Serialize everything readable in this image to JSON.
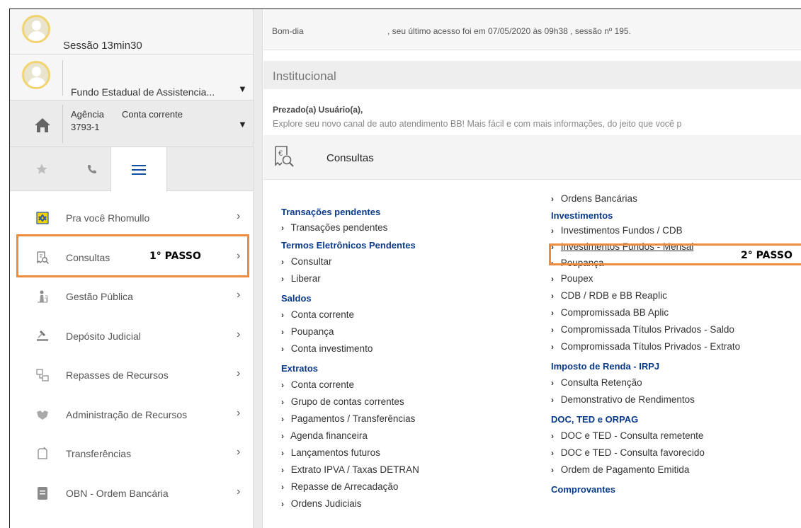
{
  "session": {
    "label": "Sessão 13min30"
  },
  "account": {
    "name": "Fundo Estadual de Assistencia..."
  },
  "agency": {
    "agency_label": "Agência",
    "account_label": "Conta corrente",
    "agency_number": "3793-1"
  },
  "tabs": [
    {
      "name": "favorites",
      "icon": "star-icon"
    },
    {
      "name": "phone",
      "icon": "phone-icon"
    },
    {
      "name": "menu",
      "icon": "menu-icon",
      "active": true
    }
  ],
  "nav": [
    {
      "label": "Pra você Rhomullo",
      "icon": "bb-logo-icon"
    },
    {
      "label": "Consultas",
      "icon": "receipt-search-icon",
      "annotation": "1° PASSO"
    },
    {
      "label": "Gestão Pública",
      "icon": "people-icon"
    },
    {
      "label": "Depósito Judicial",
      "icon": "gavel-icon"
    },
    {
      "label": "Repasses de Recursos",
      "icon": "transfer-boxes-icon"
    },
    {
      "label": "Administração de Recursos",
      "icon": "handshake-icon"
    },
    {
      "label": "Transferências",
      "icon": "transfer-icon"
    },
    {
      "label": "OBN - Ordem Bancária",
      "icon": "document-icon"
    }
  ],
  "nav_arrow": "›",
  "greeting": {
    "hello": "Bom-dia",
    "rest": ", seu último acesso foi em 07/05/2020 às 09h38 , sessão nº 195."
  },
  "section_title": "Institucional",
  "message": {
    "salutation": "Prezado(a) Usuário(a),",
    "text": "Explore seu novo canal de auto atendimento BB! Mais fácil e com mais informações, do jeito que você p"
  },
  "consultas_title": "Consultas",
  "left_column": [
    {
      "title": "Transações pendentes",
      "links": [
        "Transações pendentes"
      ]
    },
    {
      "title": "Termos Eletrônicos Pendentes",
      "links": [
        "Consultar",
        "Liberar"
      ]
    },
    {
      "title": "Saldos",
      "links": [
        "Conta corrente",
        "Poupança",
        "Conta investimento"
      ]
    },
    {
      "title": "Extratos",
      "links": [
        "Conta corrente",
        "Grupo de contas correntes",
        "Pagamentos / Transferências",
        "Agenda financeira",
        "Lançamentos futuros",
        "Extrato IPVA / Taxas DETRAN",
        "Repasse de Arrecadação",
        "Ordens Judiciais"
      ]
    }
  ],
  "right_column": {
    "top_link": "Ordens Bancárias",
    "sections": [
      {
        "title": "Investimentos",
        "links": [
          "Investimentos Fundos / CDB",
          "Investimentos Fundos - Mensal",
          "Poupança",
          "Poupex",
          "CDB / RDB e BB Reaplic",
          "Compromissada BB Aplic",
          "Compromissada Títulos Privados - Saldo",
          "Compromissada Títulos Privados - Extrato"
        ]
      },
      {
        "title": "Imposto de Renda - IRPJ",
        "links": [
          "Consulta Retenção",
          "Demonstrativo de Rendimentos"
        ]
      },
      {
        "title": "DOC, TED e ORPAG",
        "links": [
          "DOC e TED - Consulta remetente",
          "DOC e TED - Consulta favorecido",
          "Ordem de Pagamento Emitida"
        ]
      },
      {
        "title": "Comprovantes",
        "links": []
      }
    ]
  },
  "annotation_step2": "2° PASSO",
  "colors": {
    "highlight": "#f08a3c",
    "link_section": "#0a3a8a",
    "menu_accent": "#0f4ea3"
  }
}
